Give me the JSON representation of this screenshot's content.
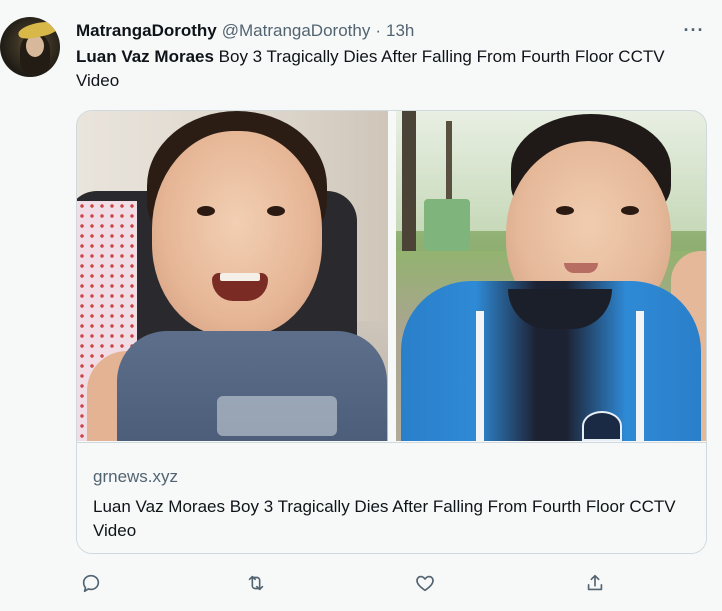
{
  "tweet": {
    "author": {
      "display_name": "MatrangaDorothy",
      "handle": "@MatrangaDorothy",
      "separator": "·",
      "time": "13h"
    },
    "more_icon": "more-horizontal-icon",
    "text": {
      "bold": "Luan Vaz Moraes",
      "rest": " Boy 3 Tragically Dies After Falling From Fourth Floor CCTV Video"
    },
    "card": {
      "domain": "grnews.xyz",
      "title": "Luan Vaz Moraes Boy 3 Tragically Dies After Falling From Fourth Floor CCTV Video",
      "images": [
        "photo-boy-smiling",
        "photo-boy-blue-shirt"
      ]
    },
    "actions": [
      "reply-icon",
      "retweet-icon",
      "like-icon",
      "share-icon"
    ]
  },
  "colors": {
    "background": "#f7f9f9",
    "text": "#0f1419",
    "secondary": "#536471",
    "border": "#cfd9de"
  }
}
